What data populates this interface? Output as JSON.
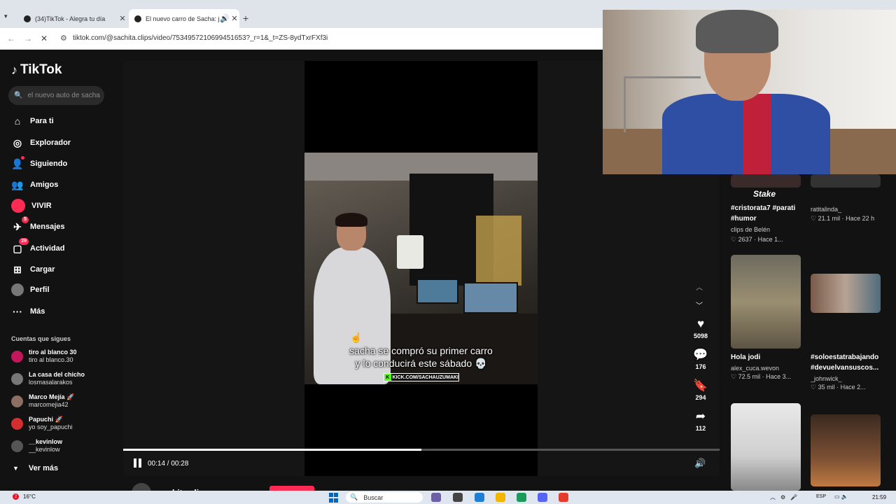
{
  "browser": {
    "tabs": [
      {
        "title": "(34)TikTok - Alegra tu día",
        "active": false
      },
      {
        "title": "El nuevo carro de Sacha: ju",
        "active": true
      }
    ],
    "url": "tiktok.com/@sachita.clips/video/7534957210699451653?_r=1&_t=ZS-8ydTxrFXf3i"
  },
  "sidebar": {
    "logo": "TikTok",
    "search_placeholder": "el nuevo auto de sacha",
    "nav": [
      {
        "label": "Para ti",
        "icon": "home-icon"
      },
      {
        "label": "Explorador",
        "icon": "compass-icon"
      },
      {
        "label": "Siguiendo",
        "icon": "following-icon"
      },
      {
        "label": "Amigos",
        "icon": "friends-icon"
      },
      {
        "label": "VIVIR",
        "icon": "live-icon"
      },
      {
        "label": "Mensajes",
        "icon": "messages-icon",
        "badge": "5"
      },
      {
        "label": "Actividad",
        "icon": "activity-icon",
        "badge": "29"
      },
      {
        "label": "Cargar",
        "icon": "upload-icon"
      },
      {
        "label": "Perfil",
        "icon": "profile-icon"
      },
      {
        "label": "Más",
        "icon": "more-icon"
      }
    ],
    "following_title": "Cuentas que sigues",
    "following": [
      {
        "name": "tiro al blanco 30",
        "user": "tiro al blanco.30",
        "color": "#c2185b"
      },
      {
        "name": "La casa del chicho",
        "user": "losmasalarakos",
        "color": "#777777"
      },
      {
        "name": "Marco Mejía 🚀",
        "user": "marcomejia42",
        "color": "#8d6e63"
      },
      {
        "name": "Papuchi 🚀",
        "user": "yo soy_papuchi",
        "color": "#d32f2f"
      },
      {
        "name": "__kevinlow",
        "user": "__kevinlow",
        "color": "#555555"
      }
    ],
    "see_more": "Ver más"
  },
  "video": {
    "caption_line1": "sacha se compró su primer carro",
    "caption_line2": "y lo conducirá este sábado 💀",
    "watermark": "KICK.COM/SACHAUZUMAKI",
    "current_time": "00:14",
    "duration": "00:28",
    "progress": 0.5,
    "author": "sachita.clips"
  },
  "actions": {
    "likes": "5098",
    "comments": "176",
    "saves": "294",
    "shares": "112"
  },
  "suggested": [
    {
      "title": "#cristorata7 #parati #humor",
      "author": "clips de Belén",
      "likes": "2637",
      "ago": "Hace 1..."
    },
    {
      "title": "",
      "author": "ratitalinda_",
      "likes": "21.1 mil",
      "ago": "Hace 22 h"
    },
    {
      "title": "Hola jodi",
      "author": "alex_cuca.wevon",
      "likes": "72.5 mil",
      "ago": "Hace 3..."
    },
    {
      "title": "#soloestatrabajando #devuelvansuscos...",
      "author": "_johnwick_",
      "likes": "35 mil",
      "ago": "Hace 2..."
    }
  ],
  "suggested_logo_text": "Stake",
  "taskbar": {
    "temp": "16°C",
    "weather_badge": "2",
    "search": "Buscar",
    "lang": "ESP",
    "time": "21:59"
  }
}
